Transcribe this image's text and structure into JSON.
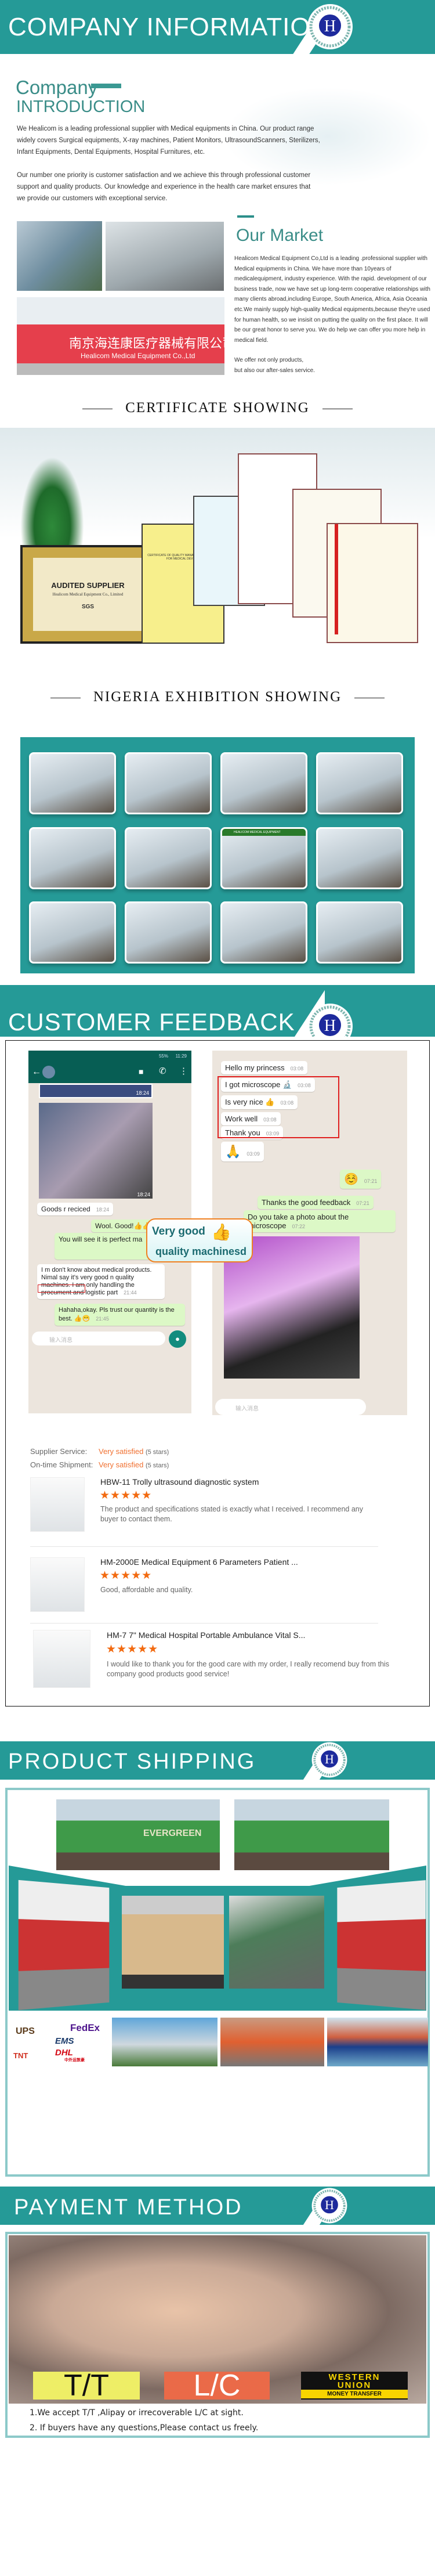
{
  "colors": {
    "brand_teal": "#259a97",
    "accent_orange": "#f26a10",
    "highlight_red": "#e02020"
  },
  "logo": {
    "letter": "H",
    "ring_text": "HEALICOM MEDICAL EQUIPMENT CO.,LTD"
  },
  "company": {
    "band_title": "COMPANY INFORMATION",
    "heading_line1": "Company",
    "heading_line2": "INTRODUCTION",
    "paragraphs": [
      "We Healicom is a leading professional supplier with  Medical equipments in China. Our product range widely covers Surgical equipments, X-ray machines, Patient Monitors, UltrasoundScanners, Sterilizers, Infant Equipments, Dental Equipments, Hospital Furnitures, etc.",
      "Our number one priority is customer satisfaction and we achieve this through professional customer support and quality products. Our knowledge and experience in the health care market ensures that we provide our customers with exceptional service."
    ],
    "banner_cn": "南京海连康医疗器械有限公司",
    "banner_en": "Healicom Medical Equipment Co.,Ltd"
  },
  "market": {
    "title": "Our Market",
    "paragraph": "Healicom Medical Equipment Co,Ltd is a leading .professional supplier with Medical equipments in China. We have more than 10years of medicalequipment,  industry experience. With the rapid. development of our business trade, now  we have set up long-term cooperative relationships  with many clients abroad,including Europe, South America, Africa, Asia Oceania etc.We mainly supply high-quality Medical equipments,because they're used for human health, so we insisit on putting the quality on the first place. It will be  our  great honor to serve  you. We do help we  can  offer  you more help in medical field.",
    "closing_line1": "We offer not only products,",
    "closing_line2": "but also our  after-sales service."
  },
  "certificate": {
    "heading": "CERTIFICATE SHOWING",
    "plaque_title": "AUDITED SUPPLIER",
    "plaque_company": "Healicom Medical Equipment Co., Limited",
    "plaque_badge": "SGS",
    "yellow_cert_title": "CERTIFICATE OF QUALITY MANAGEMENT SYSTEM FOR MEDICAL DEVICES"
  },
  "exhibition": {
    "heading": "NIGERIA EXHIBITION  SHOWING",
    "booth_sign": "HEALICOM MEDICAL EQUIPMENT"
  },
  "feedback": {
    "band_title": "CUSTOMER FEEDBACK",
    "left_chat": {
      "status_time": "11:29",
      "status_battery": "55%",
      "messages": [
        {
          "text": "",
          "time": "18:24",
          "type": "image"
        },
        {
          "text": "",
          "time": "18:24",
          "type": "image"
        },
        {
          "text": "Goods r reciced",
          "time": "18:24",
          "type": "in"
        },
        {
          "text": "Wool. Good!👍👍",
          "time": "",
          "type": "out"
        },
        {
          "text": "You will see it is perfect ma",
          "time": "",
          "type": "out"
        },
        {
          "text": "I m don't know about medical products. Nimal say it's very good n quality machines. I am only handling the procument and logistic part",
          "time": "21:44",
          "type": "in"
        },
        {
          "text": "Hahaha,okay. Pls trust our quantity is the best. 👍😁",
          "time": "21:45",
          "type": "out"
        }
      ],
      "input_placeholder": "输入消息"
    },
    "callout_line1": "Very good",
    "callout_line2": "quality machinesd",
    "right_chat": {
      "messages": [
        {
          "text": "Hello my princess",
          "time": "03:08",
          "type": "in"
        },
        {
          "text": "I got microscope 🔬",
          "time": "03:08",
          "type": "in"
        },
        {
          "text": "Is very nice 👍",
          "time": "03:08",
          "type": "in"
        },
        {
          "text": "Work well",
          "time": "03:08",
          "type": "in"
        },
        {
          "text": "Thank you",
          "time": "03:09",
          "type": "in"
        },
        {
          "text": "🙏",
          "time": "03:09",
          "type": "in"
        },
        {
          "text": "☺️",
          "time": "07:21",
          "type": "out"
        },
        {
          "text": "Thanks the good feedback",
          "time": "07:21",
          "type": "out"
        },
        {
          "text": "Do you take a photo about the microscope",
          "time": "07:22",
          "type": "out"
        }
      ],
      "input_placeholder": "输入消息"
    },
    "ratings": [
      {
        "label": "Supplier Service:",
        "value": "Very satisfied",
        "stars": "(5 stars)"
      },
      {
        "label": "On-time Shipment:",
        "value": "Very satisfied",
        "stars": "(5 stars)"
      }
    ],
    "reviews": [
      {
        "title": "HBW-11 Trolly ultrasound diagnostic system",
        "rating": 5,
        "text": "The product and specifications stated is exactly what I received. I recommend any buyer to contact them."
      },
      {
        "title": "HM-2000E Medical Equipment 6 Parameters Patient ...",
        "rating": 5,
        "text": "Good, affordable and quality."
      },
      {
        "title": "HM-7 7\" Medical Hospital Portable Ambulance Vital S...",
        "rating": 5,
        "text": "I would like to thank you for the good care with my order, I really recomend buy from this company good products good service!"
      }
    ]
  },
  "shipping": {
    "band_title": "PRODUCT  SHIPPING",
    "container_label": "EVERGREEN",
    "couriers": [
      "UPS",
      "FedEx",
      "EMS",
      "TNT",
      "DHL"
    ],
    "courier_cn": "中外运敦豪"
  },
  "payment": {
    "band_title": "PAYMENT  METHOD",
    "methods": [
      "T/T",
      "L/C"
    ],
    "western_union_line1": "WESTERN",
    "western_union_line2": "UNION",
    "western_union_line3": "MONEY TRANSFER",
    "notes": [
      "1.We accept T/T ,Alipay or irrecoverable L/C at sight.",
      "2. If buyers have any questions,Please contact us freely."
    ]
  }
}
